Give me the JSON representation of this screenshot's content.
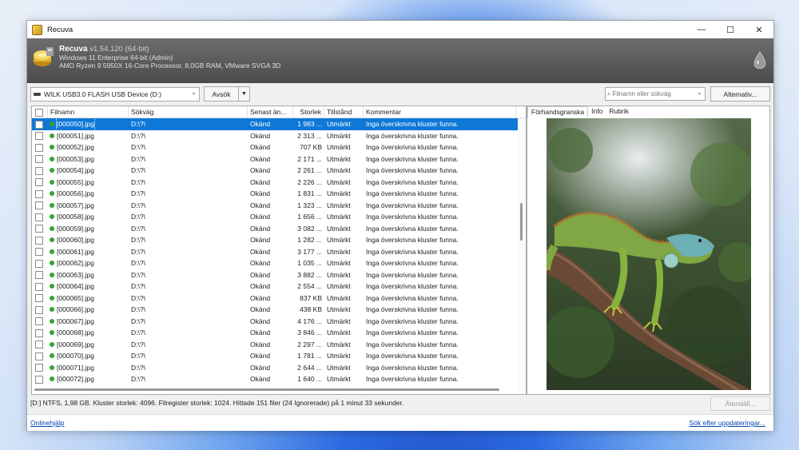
{
  "window": {
    "title": "Recuva",
    "minimize_glyph": "—",
    "maximize_glyph": "☐",
    "close_glyph": "✕"
  },
  "header": {
    "app_name": "Recuva",
    "version": "v1.54.120 (64-bit)",
    "os_info": "Windows 11 Enterprise 64-bit (Admin)",
    "hw_info": "AMD Ryzen 9 5950X 16-Core Processor, 8,0GB RAM, VMware SVGA 3D"
  },
  "toolbar": {
    "drive": "WILK USB3.0 FLASH USB Device (D:)",
    "scan_label": "Avsök",
    "search_placeholder": "Filnamn eller sökväg",
    "options_label": "Alternativ..."
  },
  "columns": {
    "name": "Filnamn",
    "path": "Sökväg",
    "date": "Senast än...",
    "size": "Storlek",
    "state": "Tillstånd",
    "comment": "Kommentar"
  },
  "files": [
    {
      "name": "[000050].jpg",
      "path": "D:\\?\\",
      "date": "Okänd",
      "size": "1 983 ...",
      "state": "Utmärkt",
      "comment": "Inga överskrivna kluster funna."
    },
    {
      "name": "[000051].jpg",
      "path": "D:\\?\\",
      "date": "Okänd",
      "size": "2 313 ...",
      "state": "Utmärkt",
      "comment": "Inga överskrivna kluster funna."
    },
    {
      "name": "[000052].jpg",
      "path": "D:\\?\\",
      "date": "Okänd",
      "size": "707 KB",
      "state": "Utmärkt",
      "comment": "Inga överskrivna kluster funna."
    },
    {
      "name": "[000053].jpg",
      "path": "D:\\?\\",
      "date": "Okänd",
      "size": "2 171 ...",
      "state": "Utmärkt",
      "comment": "Inga överskrivna kluster funna."
    },
    {
      "name": "[000054].jpg",
      "path": "D:\\?\\",
      "date": "Okänd",
      "size": "2 261 ...",
      "state": "Utmärkt",
      "comment": "Inga överskrivna kluster funna."
    },
    {
      "name": "[000055].jpg",
      "path": "D:\\?\\",
      "date": "Okänd",
      "size": "2 226 ...",
      "state": "Utmärkt",
      "comment": "Inga överskrivna kluster funna."
    },
    {
      "name": "[000056].jpg",
      "path": "D:\\?\\",
      "date": "Okänd",
      "size": "1 831 ...",
      "state": "Utmärkt",
      "comment": "Inga överskrivna kluster funna."
    },
    {
      "name": "[000057].jpg",
      "path": "D:\\?\\",
      "date": "Okänd",
      "size": "1 323 ...",
      "state": "Utmärkt",
      "comment": "Inga överskrivna kluster funna."
    },
    {
      "name": "[000058].jpg",
      "path": "D:\\?\\",
      "date": "Okänd",
      "size": "1 656 ...",
      "state": "Utmärkt",
      "comment": "Inga överskrivna kluster funna."
    },
    {
      "name": "[000059].jpg",
      "path": "D:\\?\\",
      "date": "Okänd",
      "size": "3 082 ...",
      "state": "Utmärkt",
      "comment": "Inga överskrivna kluster funna."
    },
    {
      "name": "[000060].jpg",
      "path": "D:\\?\\",
      "date": "Okänd",
      "size": "1 282 ...",
      "state": "Utmärkt",
      "comment": "Inga överskrivna kluster funna."
    },
    {
      "name": "[000061].jpg",
      "path": "D:\\?\\",
      "date": "Okänd",
      "size": "3 177 ...",
      "state": "Utmärkt",
      "comment": "Inga överskrivna kluster funna."
    },
    {
      "name": "[000062].jpg",
      "path": "D:\\?\\",
      "date": "Okänd",
      "size": "1 035 ...",
      "state": "Utmärkt",
      "comment": "Inga överskrivna kluster funna."
    },
    {
      "name": "[000063].jpg",
      "path": "D:\\?\\",
      "date": "Okänd",
      "size": "3 882 ...",
      "state": "Utmärkt",
      "comment": "Inga överskrivna kluster funna."
    },
    {
      "name": "[000064].jpg",
      "path": "D:\\?\\",
      "date": "Okänd",
      "size": "2 554 ...",
      "state": "Utmärkt",
      "comment": "Inga överskrivna kluster funna."
    },
    {
      "name": "[000065].jpg",
      "path": "D:\\?\\",
      "date": "Okänd",
      "size": "837 KB",
      "state": "Utmärkt",
      "comment": "Inga överskrivna kluster funna."
    },
    {
      "name": "[000066].jpg",
      "path": "D:\\?\\",
      "date": "Okänd",
      "size": "438 KB",
      "state": "Utmärkt",
      "comment": "Inga överskrivna kluster funna."
    },
    {
      "name": "[000067].jpg",
      "path": "D:\\?\\",
      "date": "Okänd",
      "size": "4 176 ...",
      "state": "Utmärkt",
      "comment": "Inga överskrivna kluster funna."
    },
    {
      "name": "[000068].jpg",
      "path": "D:\\?\\",
      "date": "Okänd",
      "size": "3 846 ...",
      "state": "Utmärkt",
      "comment": "Inga överskrivna kluster funna."
    },
    {
      "name": "[000069].jpg",
      "path": "D:\\?\\",
      "date": "Okänd",
      "size": "2 297 ...",
      "state": "Utmärkt",
      "comment": "Inga överskrivna kluster funna."
    },
    {
      "name": "[000070].jpg",
      "path": "D:\\?\\",
      "date": "Okänd",
      "size": "1 781 ...",
      "state": "Utmärkt",
      "comment": "Inga överskrivna kluster funna."
    },
    {
      "name": "[000071].jpg",
      "path": "D:\\?\\",
      "date": "Okänd",
      "size": "2 644 ...",
      "state": "Utmärkt",
      "comment": "Inga överskrivna kluster funna."
    },
    {
      "name": "[000072].jpg",
      "path": "D:\\?\\",
      "date": "Okänd",
      "size": "1 640 ...",
      "state": "Utmärkt",
      "comment": "Inga överskrivna kluster funna."
    }
  ],
  "selected_index": 0,
  "preview": {
    "tabs": [
      "Förhandsgranska",
      "Info",
      "Rubrik"
    ],
    "active_tab": 0
  },
  "status": {
    "text": "[D:] NTFS, 1,98 GB. Kluster storlek: 4096. Filregister storlek: 1024. Hittade 151 filer (24 Ignorerade) på 1 minut 33 sekunder.",
    "restore_label": "Återställ..."
  },
  "footer": {
    "help_link": "Onlinehjälp",
    "update_link": "Sök efter uppdateringar..."
  },
  "colors": {
    "selection": "#0f78d7",
    "state_ok": "#35a334",
    "header_bg": "#5a5a5a",
    "link": "#0645ad"
  }
}
